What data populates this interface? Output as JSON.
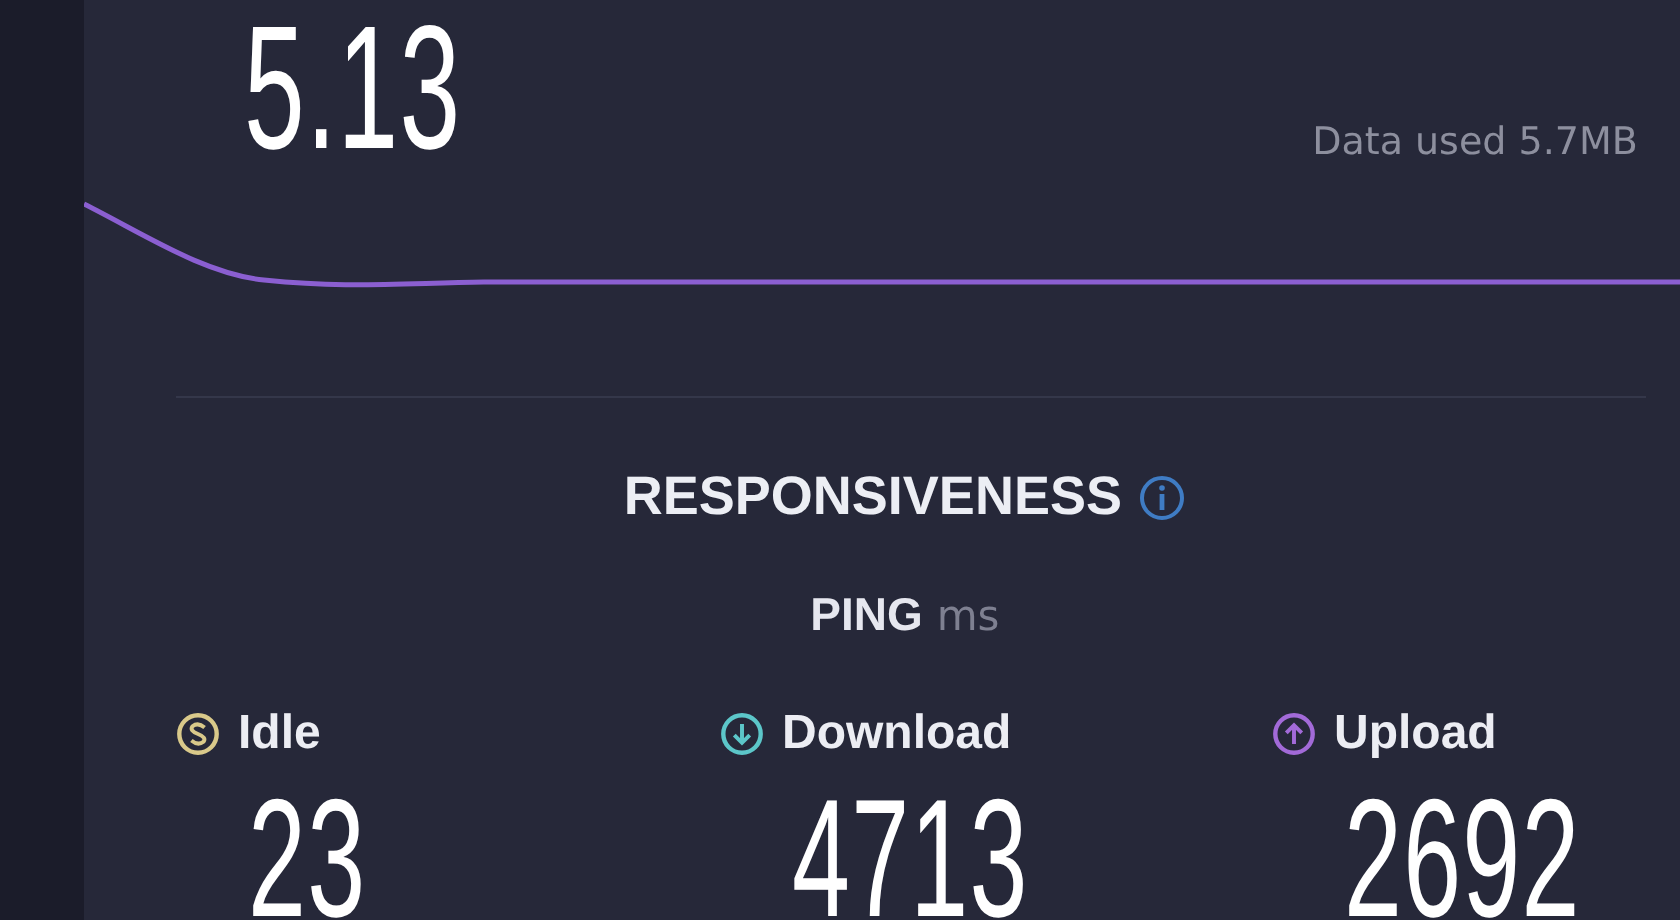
{
  "result": {
    "value": "5.13",
    "data_used": "Data used 5.7MB"
  },
  "responsiveness": {
    "title": "RESPONSIVENESS",
    "ping_label": "PING",
    "ping_unit": "ms",
    "metrics": [
      {
        "kind": "idle",
        "label": "Idle",
        "value": "23"
      },
      {
        "kind": "download",
        "label": "Download",
        "value": "4713"
      },
      {
        "kind": "upload",
        "label": "Upload",
        "value": "2692"
      }
    ]
  }
}
